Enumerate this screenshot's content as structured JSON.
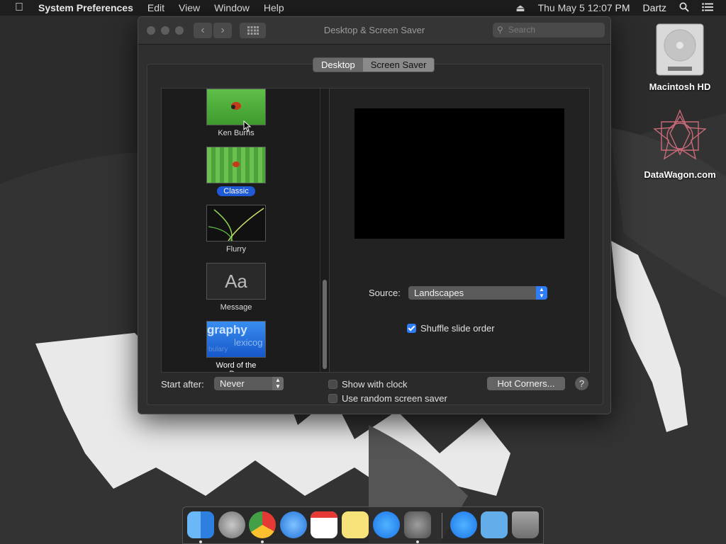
{
  "menubar": {
    "app_name": "System Preferences",
    "menus": [
      "Edit",
      "View",
      "Window",
      "Help"
    ],
    "clock": "Thu May 5  12:07 PM",
    "user": "Dartz"
  },
  "desktop_icons": {
    "hd_label": "Macintosh HD",
    "datawagon_label": "DataWagon.com"
  },
  "window": {
    "title": "Desktop & Screen Saver",
    "search_placeholder": "Search",
    "tabs": [
      {
        "label": "Desktop",
        "selected": false
      },
      {
        "label": "Screen Saver",
        "selected": true
      }
    ]
  },
  "savers": [
    {
      "name": "Ken Burns",
      "selected": false
    },
    {
      "name": "Classic",
      "selected": true
    },
    {
      "name": "Flurry",
      "selected": false
    },
    {
      "name": "Message",
      "selected": false
    },
    {
      "name": "Word of the Day",
      "selected": false
    }
  ],
  "thumb_text": {
    "message": "Aa",
    "word_of_day_1": "graphy",
    "word_of_day_2": "lexicog",
    "word_of_day_3": "bulary"
  },
  "options": {
    "source_label": "Source:",
    "source_value": "Landscapes",
    "shuffle_label": "Shuffle slide order",
    "shuffle_checked": true,
    "start_after_label": "Start after:",
    "start_after_value": "Never",
    "show_clock_label": "Show with clock",
    "show_clock_checked": false,
    "random_label": "Use random screen saver",
    "random_checked": false,
    "hot_corners_label": "Hot Corners...",
    "help_label": "?"
  },
  "colors": {
    "accent": "#2f7df6",
    "selection": "#1f5bd6"
  },
  "icons": [
    "apple-icon",
    "eject-icon",
    "spotlight-icon",
    "notification-center-icon",
    "search-icon",
    "grid-icon"
  ]
}
